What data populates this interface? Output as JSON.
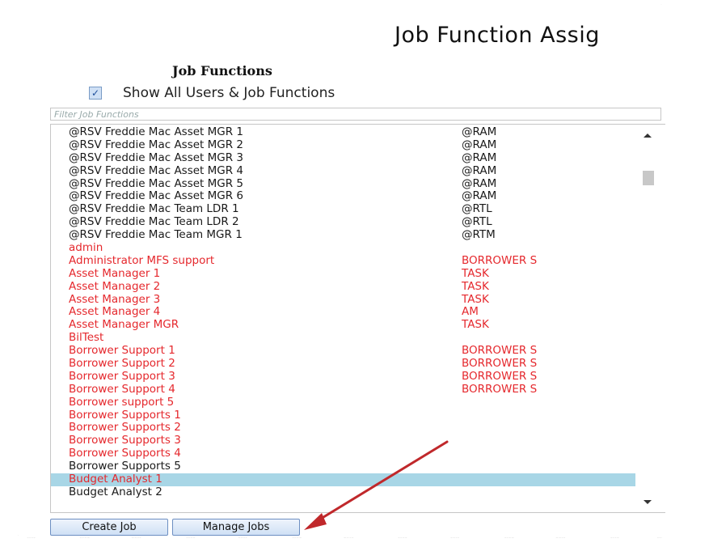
{
  "page": {
    "title": "Job Function Assig",
    "section_title": "Job Functions",
    "show_all_label": "Show All Users & Job Functions",
    "show_all_checked": true,
    "filter_placeholder": "Filter Job Functions"
  },
  "job_functions": [
    {
      "name": "@RSV Freddie Mac Asset MGR 1",
      "code": "@RAM",
      "color": "black"
    },
    {
      "name": "@RSV Freddie Mac Asset MGR 2",
      "code": "@RAM",
      "color": "black"
    },
    {
      "name": "@RSV Freddie Mac Asset MGR 3",
      "code": "@RAM",
      "color": "black"
    },
    {
      "name": "@RSV Freddie Mac Asset MGR 4",
      "code": "@RAM",
      "color": "black"
    },
    {
      "name": "@RSV Freddie Mac Asset MGR 5",
      "code": "@RAM",
      "color": "black"
    },
    {
      "name": "@RSV Freddie Mac Asset MGR 6",
      "code": "@RAM",
      "color": "black"
    },
    {
      "name": "@RSV Freddie Mac Team LDR 1",
      "code": "@RTL",
      "color": "black"
    },
    {
      "name": "@RSV Freddie Mac Team LDR 2",
      "code": "@RTL",
      "color": "black"
    },
    {
      "name": "@RSV Freddie Mac Team MGR 1",
      "code": "@RTM",
      "color": "black"
    },
    {
      "name": "admin",
      "code": "",
      "color": "red"
    },
    {
      "name": "Administrator MFS support",
      "code": "BORROWER S",
      "color": "red"
    },
    {
      "name": "Asset Manager 1",
      "code": "TASK",
      "color": "red"
    },
    {
      "name": "Asset Manager 2",
      "code": "TASK",
      "color": "red"
    },
    {
      "name": "Asset Manager 3",
      "code": "TASK",
      "color": "red"
    },
    {
      "name": "Asset Manager 4",
      "code": "AM",
      "color": "red"
    },
    {
      "name": "Asset Manager MGR",
      "code": "TASK",
      "color": "red"
    },
    {
      "name": "BilTest",
      "code": "",
      "color": "red"
    },
    {
      "name": "Borrower Support 1",
      "code": "BORROWER S",
      "color": "red"
    },
    {
      "name": "Borrower Support 2",
      "code": "BORROWER S",
      "color": "red"
    },
    {
      "name": "Borrower Support 3",
      "code": "BORROWER S",
      "color": "red"
    },
    {
      "name": "Borrower Support 4",
      "code": "BORROWER S",
      "color": "red"
    },
    {
      "name": "Borrower support 5",
      "code": "",
      "color": "red"
    },
    {
      "name": "Borrower Supports 1",
      "code": "",
      "color": "red"
    },
    {
      "name": "Borrower Supports 2",
      "code": "",
      "color": "red"
    },
    {
      "name": "Borrower Supports 3",
      "code": "",
      "color": "red"
    },
    {
      "name": "Borrower Supports 4",
      "code": "",
      "color": "red"
    },
    {
      "name": "Borrower Supports 5",
      "code": "",
      "color": "black"
    },
    {
      "name": "Budget Analyst 1",
      "code": "",
      "color": "red",
      "selected": true
    },
    {
      "name": "Budget Analyst 2",
      "code": "",
      "color": "black"
    }
  ],
  "buttons": {
    "create_job": "Create Job",
    "manage_jobs": "Manage Jobs"
  },
  "colors": {
    "inactive_text": "#e5282d",
    "active_text": "#1a1a1a",
    "selected_row": "#a8d6e6",
    "annotation_arrow": "#c0282b"
  },
  "icons": {
    "checkbox": "checkmark-icon",
    "scroll_up": "triangle-up-icon",
    "scroll_down": "triangle-down-icon",
    "annotation": "red-arrow-icon"
  }
}
